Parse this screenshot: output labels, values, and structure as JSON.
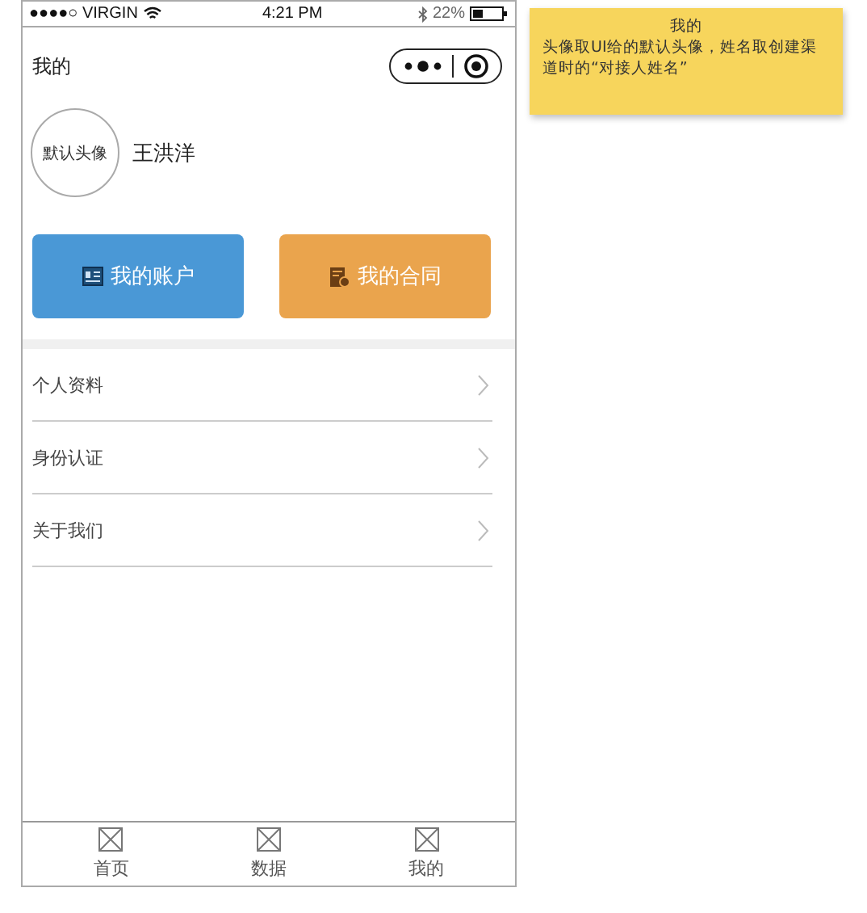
{
  "status_bar": {
    "carrier": "●●●●○ VIRGIN",
    "time": "4:21 PM",
    "battery": "22%"
  },
  "header": {
    "title": "我的"
  },
  "profile": {
    "avatar": "默认头像",
    "name": "王洪洋"
  },
  "actions": [
    {
      "label": "我的账户",
      "color": "#4a98d6",
      "kind": "account"
    },
    {
      "label": "我的合同",
      "color": "#eaa44d",
      "kind": "contract"
    }
  ],
  "menu": [
    {
      "label": "个人资料"
    },
    {
      "label": "身份认证"
    },
    {
      "label": "关于我们"
    }
  ],
  "tab_bar": [
    {
      "label": "首页"
    },
    {
      "label": "数据"
    },
    {
      "label": "我的"
    }
  ],
  "note": {
    "title": "我的",
    "text": "头像取UI给的默认头像，姓名取创建渠道时的“对接人姓名”"
  }
}
